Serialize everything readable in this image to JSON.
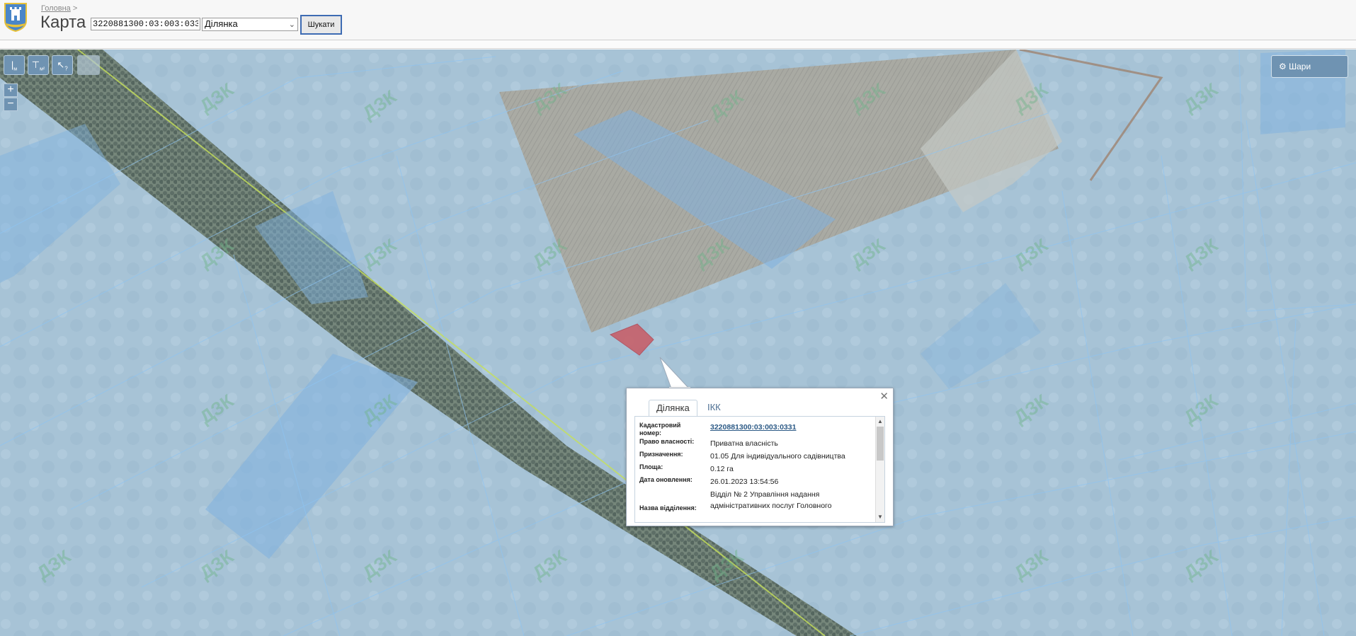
{
  "header": {
    "breadcrumb_home": "Головна",
    "breadcrumb_sep": ">",
    "title": "Карта",
    "search_value": "3220881300:03:003:0331",
    "type_selected": "Ділянка",
    "search_button": "Шукати"
  },
  "map_controls": {
    "tools": [
      "measure-length-tool",
      "measure-area-tool",
      "identify-tool"
    ],
    "tool_labels": [
      "м",
      "м²",
      "?"
    ],
    "zoom_in": "+",
    "zoom_out": "−",
    "layers_button": "Шари"
  },
  "watermark_text": "ДЗК",
  "popup": {
    "tabs": [
      "Ділянка",
      "ІКК"
    ],
    "active_tab": "Ділянка",
    "rows": [
      {
        "label": "Кадастровий номер:",
        "value": "3220881300:03:003:0331"
      },
      {
        "label": "Право власності:",
        "value": "Приватна власність"
      },
      {
        "label": "Призначення:",
        "value": "01.05 Для індивідуального садівництва"
      },
      {
        "label": "Площа:",
        "value": "0.12 га"
      },
      {
        "label": "Дата оновлення:",
        "value": "26.01.2023 13:54:56"
      },
      {
        "label": "Назва відділення:",
        "value": "Відділ № 2 Управління надання адміністративних послуг Головного"
      }
    ]
  }
}
